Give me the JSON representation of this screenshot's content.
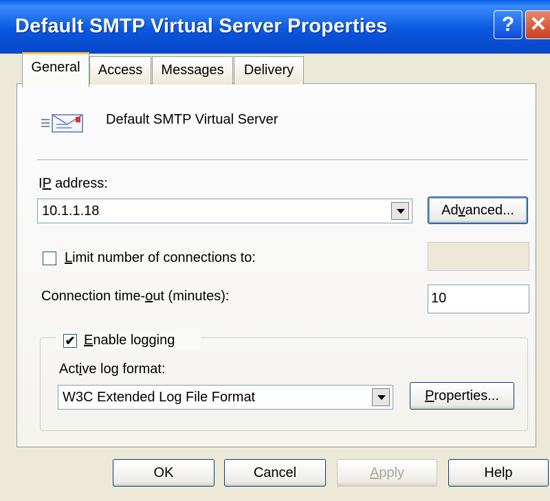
{
  "window": {
    "title": "Default SMTP Virtual Server Properties",
    "help_glyph": "?",
    "close_glyph": "✕"
  },
  "tabs": [
    {
      "label": "General",
      "active": true
    },
    {
      "label": "Access",
      "active": false
    },
    {
      "label": "Messages",
      "active": false
    },
    {
      "label": "Delivery",
      "active": false
    }
  ],
  "general": {
    "server_name": "Default SMTP Virtual Server",
    "server_icon": "mail-server-icon",
    "ip_address_label_pre": "I",
    "ip_address_label_mn": "P",
    "ip_address_label_post": " address:",
    "ip_address_value": "10.1.1.18",
    "advanced_pre": "Ad",
    "advanced_mn": "v",
    "advanced_post": "anced...",
    "limit_connections_mn": "L",
    "limit_connections_post": "imit number of connections to:",
    "limit_connections_checked": false,
    "limit_connections_value": "",
    "timeout_label_pre": "Connection time-",
    "timeout_label_mn": "o",
    "timeout_label_post": "ut (minutes):",
    "timeout_value": "10",
    "enable_logging_mn": "E",
    "enable_logging_post": "nable logging",
    "enable_logging_checked": true,
    "checkmark": "✔",
    "log_format_label_pre": "Act",
    "log_format_label_mn": "i",
    "log_format_label_post": "ve log format:",
    "log_format_value": "W3C Extended Log File Format",
    "properties_pre": "",
    "properties_mn": "P",
    "properties_post": "roperties..."
  },
  "buttons": {
    "ok": "OK",
    "cancel": "Cancel",
    "apply_mn": "A",
    "apply_post": "pply",
    "help": "Help"
  },
  "colors": {
    "titlebar": "#0a57de",
    "dialog_bg": "#ece9d8",
    "active_tab_accent": "#ffc73c"
  }
}
